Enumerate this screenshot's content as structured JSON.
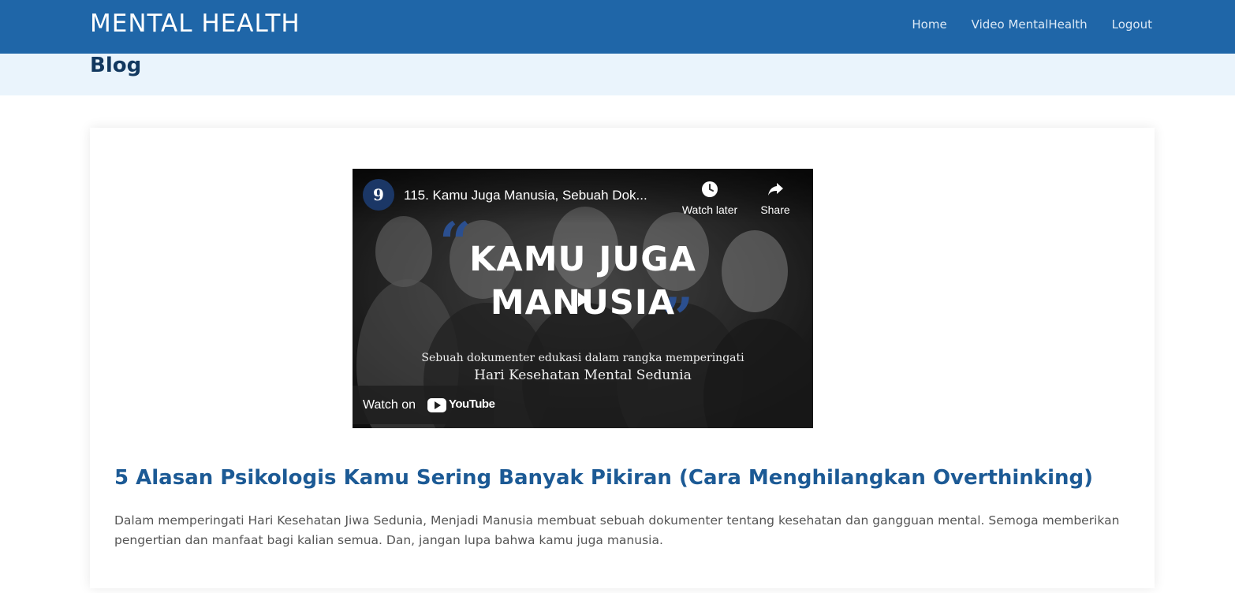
{
  "navbar": {
    "brand": "MENTAL HEALTH",
    "links": [
      "Home",
      "Video MentalHealth",
      "Logout"
    ],
    "bg_color": "#1f66a8"
  },
  "breadcrumb": {
    "heading": "Blog",
    "bg_color": "#eaf4fc"
  },
  "video": {
    "title": "115. Kamu Juga Manusia, Sebuah Dok...",
    "channel_initial": "9",
    "watch_later_label": "Watch later",
    "share_label": "Share",
    "overlay_line1": "KAMU JUGA",
    "overlay_line2": "MANUSIA",
    "overlay_sub1": "Sebuah dokumenter edukasi dalam rangka memperingati",
    "overlay_sub2": "Hari Kesehatan Mental Sedunia",
    "watch_on_label": "Watch on",
    "youtube_label": "YouTube",
    "icons": [
      "clock-icon",
      "share-arrow-icon",
      "play-icon",
      "youtube-logo-icon"
    ]
  },
  "post": {
    "title": "5 Alasan Psikologis Kamu Sering Banyak Pikiran (Cara Menghilangkan Overthinking)",
    "excerpt": "Dalam memperingati Hari Kesehatan Jiwa Sedunia, Menjadi Manusia membuat sebuah dokumenter tentang kesehatan dan gangguan mental. Semoga memberikan pengertian dan manfaat bagi kalian semua. Dan, jangan lupa bahwa kamu juga manusia.",
    "title_color": "#1c5a95"
  }
}
